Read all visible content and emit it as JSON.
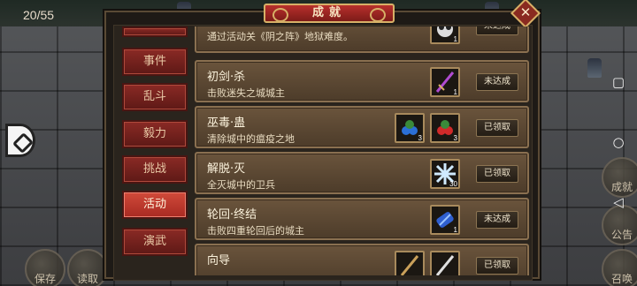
{
  "hud": {
    "counter": "20/55",
    "save_label": "保存",
    "quit_label": "读取",
    "right_top_label": "成就",
    "right_mid_label": "公告",
    "right_bottom_label": "召唤"
  },
  "dialog": {
    "title": "成就",
    "close_glyph": "✕"
  },
  "tabs": [
    {
      "label": "事件"
    },
    {
      "label": "乱斗"
    },
    {
      "label": "毅力"
    },
    {
      "label": "挑战"
    },
    {
      "label": "活动"
    },
    {
      "label": "演武"
    }
  ],
  "active_tab": "活动",
  "achievements": [
    {
      "name": "",
      "desc": "通过活动关《阴之阵》地狱难度。",
      "items": [
        {
          "icon": "skull-orb-icon",
          "qty": "1"
        }
      ],
      "status": "未达成"
    },
    {
      "name": "初剑·杀",
      "desc": "击败迷失之城城主",
      "items": [
        {
          "icon": "sword-icon",
          "qty": "1"
        }
      ],
      "status": "未达成"
    },
    {
      "name": "巫毒·蛊",
      "desc": "清除城中的瘟疫之地",
      "items": [
        {
          "icon": "blue-berry-icon",
          "qty": "3"
        },
        {
          "icon": "red-berry-icon",
          "qty": "3"
        }
      ],
      "status": "已领取"
    },
    {
      "name": "解脱·灭",
      "desc": "全灭城中的卫兵",
      "items": [
        {
          "icon": "ice-crystal-icon",
          "qty": "30"
        }
      ],
      "status": "已领取"
    },
    {
      "name": "轮回·终结",
      "desc": "击败四重轮回后的城主",
      "items": [
        {
          "icon": "blue-scroll-icon",
          "qty": "1"
        }
      ],
      "status": "未达成"
    },
    {
      "name": "向导",
      "desc": "",
      "items": [
        {
          "icon": "staff-icon",
          "qty": ""
        },
        {
          "icon": "blade-icon",
          "qty": ""
        }
      ],
      "status": "已领取"
    }
  ]
}
